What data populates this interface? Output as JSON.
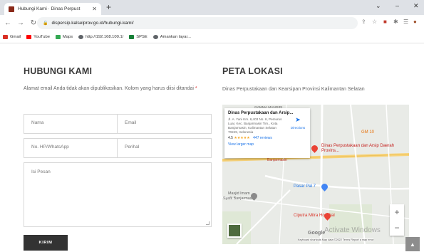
{
  "browser": {
    "tab_title": "Hubungi Kami · Dinas Perpust",
    "url": "dispersip.kalselprov.go.id/hubungi-kami/",
    "bookmarks": [
      {
        "label": "Gmail",
        "color": "#d93025"
      },
      {
        "label": "YouTube",
        "color": "#ff0000"
      },
      {
        "label": "Maps",
        "color": "#34a853"
      },
      {
        "label": "http://192.168.100.1/",
        "color": "#5f6368"
      },
      {
        "label": "SPSE",
        "color": "#188038"
      },
      {
        "label": "Amankan layar...",
        "color": "#5f6368"
      }
    ]
  },
  "contact": {
    "heading": "HUBUNGI KAMI",
    "note": "Alamat email Anda tidak akan dipublikasikan. Kolom yang harus diisi ditandai",
    "required_mark": "*",
    "placeholders": {
      "nama": "Nama",
      "email": "Email",
      "hp": "No. HP/WhatsApp",
      "perihal": "Perihal",
      "pesan": "Isi Pesan"
    },
    "submit_label": "KIRIM"
  },
  "location": {
    "heading": "PETA LOKASI",
    "subtitle": "Dinas Perpustakaan dan Kearsipan Provinsi Kalimantan Selatan"
  },
  "map": {
    "card_title": "Dinas Perpustakaan dan Arsip...",
    "card_address": "Jl. A. Yani Km. 6,403 No. 6, Pemurus Luar, Kec. Banjarmasin Tim., Kota Banjarmasin, Kalimantan Selatan 70249, Indonesia",
    "rating": "4.5",
    "stars": "★★★★★",
    "reviews": "447 reviews",
    "larger_map": "View larger map",
    "directions": "Directions",
    "pin_label": "Dinas Perpustakaan dan Arsip Daerah Provins...",
    "places": {
      "pasar": "Pasar Pal 7",
      "masjid": "Masjid Imam\nSyafii Banjarmasin",
      "hospital": "Ciputra Mitra Hospital",
      "road": "Banjarmasin",
      "top": "GAMMA MANDIRI",
      "gm": "GM 10"
    },
    "google": "Google",
    "watermark": "Activate Windows",
    "attribution": "Keyboard shortcuts   Map data ©2022   Terms   Report a map error"
  }
}
